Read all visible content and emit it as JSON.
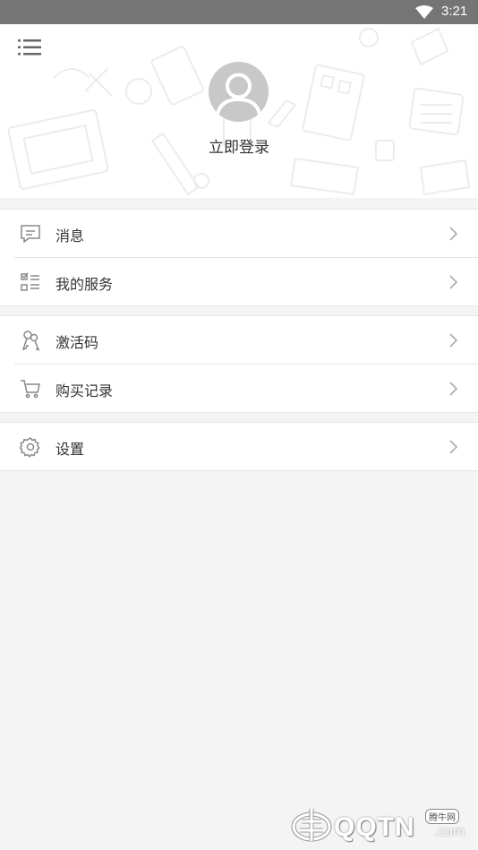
{
  "status_bar": {
    "time": "3:21",
    "icons": [
      "wifi-icon"
    ]
  },
  "header": {
    "menu_icon": "list-menu-icon",
    "avatar_icon": "user-avatar-icon",
    "login_label": "立即登录"
  },
  "menu_groups": [
    {
      "items": [
        {
          "label": "消息",
          "icon": "message-icon"
        },
        {
          "label": "我的服务",
          "icon": "checklist-icon"
        }
      ]
    },
    {
      "items": [
        {
          "label": "激活码",
          "icon": "keys-icon"
        },
        {
          "label": "购买记录",
          "icon": "cart-icon"
        }
      ]
    },
    {
      "items": [
        {
          "label": "设置",
          "icon": "gear-icon"
        }
      ]
    }
  ],
  "watermark": {
    "brand": "QQTN",
    "suffix": ".com",
    "tag": "腾牛网"
  },
  "colors": {
    "background": "#f4f4f4",
    "status_bar": "#757575",
    "text": "#333333",
    "icon": "#888888"
  }
}
